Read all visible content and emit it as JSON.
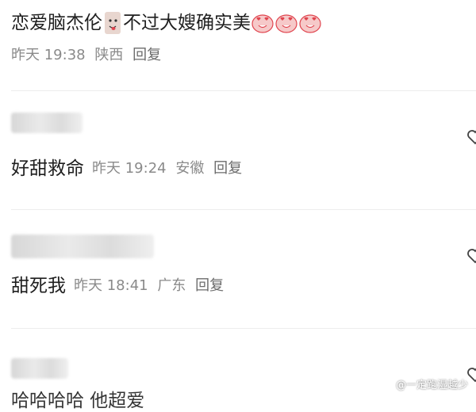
{
  "comments": [
    {
      "text_part1": "恋爱脑杰伦",
      "text_part2": "不过大嫂确实美",
      "time": "昨天 19:38",
      "location": "陕西",
      "reply_label": "回复"
    },
    {
      "text": "好甜救命",
      "time": "昨天 19:24",
      "location": "安徽",
      "reply_label": "回复"
    },
    {
      "text": "甜死我",
      "time": "昨天 18:41",
      "location": "广东",
      "reply_label": "回复"
    },
    {
      "text_partial": "哈哈哈哈 他超爱"
    }
  ],
  "watermark": "@一定跑湿越少",
  "colors": {
    "meta": "#8a8a8a",
    "sticker_red": "#e0454f",
    "divider": "#ededed"
  },
  "icons": {
    "like": "heart-outline-icon",
    "sticker": "tongue-face-sticker",
    "emoji": "heart-eyes-face-emoji"
  }
}
